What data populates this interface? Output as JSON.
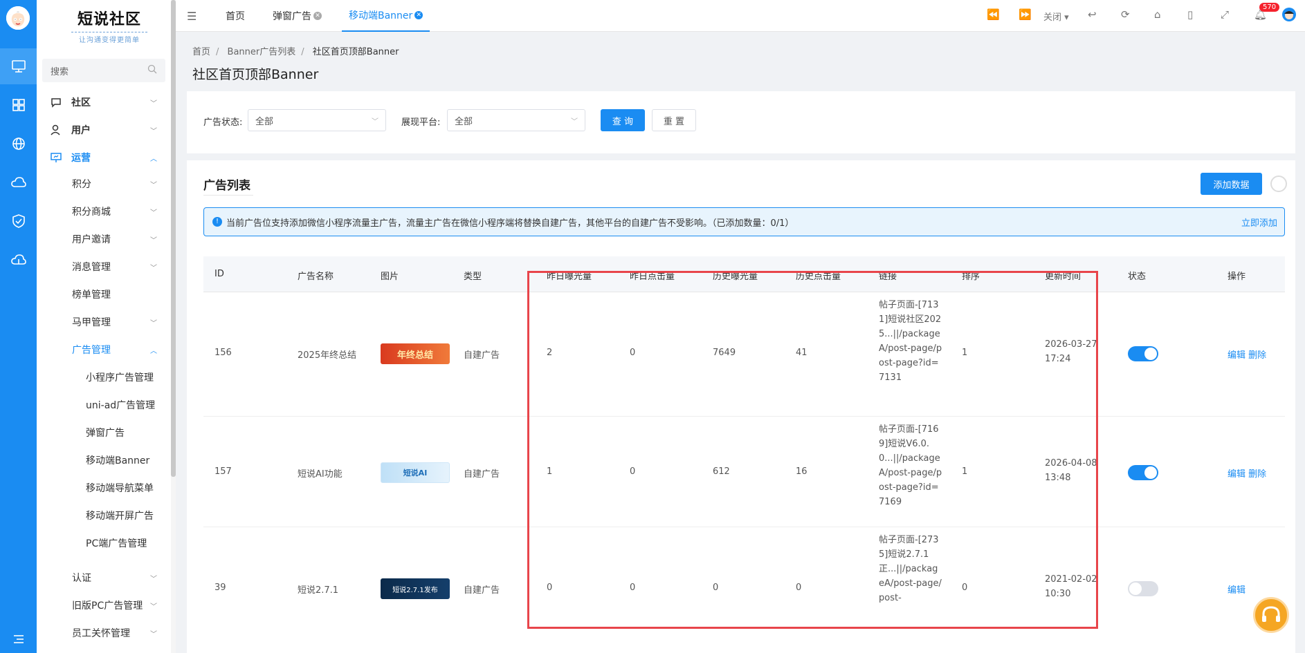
{
  "sidebar": {
    "logo_title": "短说社区",
    "logo_subtitle": "让沟通变得更简单",
    "search_placeholder": "搜索",
    "groups": [
      {
        "label": "社区",
        "expanded": false
      },
      {
        "label": "用户",
        "expanded": false
      },
      {
        "label": "运营",
        "expanded": true
      }
    ],
    "ops_items": [
      "积分",
      "积分商城",
      "用户邀请",
      "消息管理",
      "榜单管理",
      "马甲管理",
      "广告管理"
    ],
    "ad_items": [
      "小程序广告管理",
      "uni-ad广告管理",
      "弹窗广告",
      "移动端Banner",
      "移动端导航菜单",
      "移动端开屏广告",
      "PC端广告管理"
    ],
    "tail_items": [
      "认证",
      "旧版PC广告管理",
      "员工关怀管理"
    ]
  },
  "topbar": {
    "tabs": [
      {
        "label": "首页"
      },
      {
        "label": "弹窗广告"
      },
      {
        "label": "移动端Banner"
      }
    ],
    "close_label": "关闭",
    "badge": "570"
  },
  "page": {
    "breadcrumb": [
      "首页",
      "Banner广告列表",
      "社区首页顶部Banner"
    ],
    "title": "社区首页顶部Banner",
    "filter": {
      "status_label": "广告状态:",
      "status_value": "全部",
      "platform_label": "展现平台:",
      "platform_value": "全部",
      "query_btn": "查 询",
      "reset_btn": "重 置"
    },
    "list_title": "广告列表",
    "add_btn": "添加数据",
    "alert_text": "当前广告位支持添加微信小程序流量主广告，流量主广告在微信小程序端将替换自建广告，其他平台的自建广告不受影响。（已添加数量：0/1）",
    "alert_link": "立即添加",
    "columns": [
      "ID",
      "广告名称",
      "图片",
      "类型",
      "昨日曝光量",
      "昨日点击量",
      "历史曝光量",
      "历史点击量",
      "链接",
      "排序",
      "更新时间",
      "状态",
      "操作"
    ],
    "rows": [
      {
        "id": "156",
        "name": "2025年终总结",
        "img_text": "年终总结",
        "type": "自建广告",
        "y_exp": "2",
        "y_clk": "0",
        "h_exp": "7649",
        "h_clk": "41",
        "link": "帖子页面-[7131]短说社区2025...||/packageA/post-page/post-page?id=7131",
        "sort": "1",
        "date": "2026-03-27",
        "time": "17:24",
        "enabled": true
      },
      {
        "id": "157",
        "name": "短说AI功能",
        "img_text": "短说AI",
        "type": "自建广告",
        "y_exp": "1",
        "y_clk": "0",
        "h_exp": "612",
        "h_clk": "16",
        "link": "帖子页面-[7169]短说V6.0.0...||/packageA/post-page/post-page?id=7169",
        "sort": "1",
        "date": "2026-04-08",
        "time": "13:48",
        "enabled": true
      },
      {
        "id": "39",
        "name": "短说2.7.1",
        "img_text": "短说2.7.1发布",
        "type": "自建广告",
        "y_exp": "0",
        "y_clk": "0",
        "h_exp": "0",
        "h_clk": "0",
        "link": "帖子页面-[2735]短说2.7.1正...||/packageA/post-page/post-",
        "sort": "0",
        "date": "2021-02-02",
        "time": "10:30",
        "enabled": false
      }
    ],
    "op_edit": "编辑",
    "op_delete": "删除"
  },
  "colors": {
    "accent": "#1a8cf2",
    "highlight": "#e8454b"
  }
}
